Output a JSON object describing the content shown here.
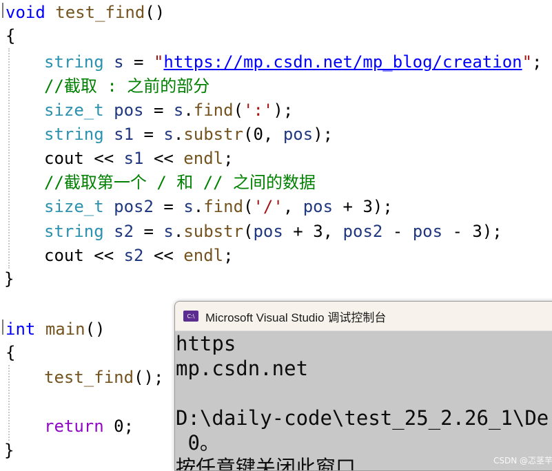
{
  "code": {
    "l1": {
      "kw": "void",
      "fn": "test_find",
      "rest": "()"
    },
    "l2": "{",
    "l3": {
      "type": "string",
      "var": "s",
      "op": " = ",
      "q1": "\"",
      "url": "https://mp.csdn.net/mp_blog/creation",
      "q2": "\"",
      "end": ";"
    },
    "l4": "//截取 : 之前的部分",
    "l5": {
      "type": "size_t",
      "var": "pos",
      "op": " = ",
      "obj": "s",
      "dot": ".",
      "fn": "find",
      "open": "(",
      "str": "':'",
      "close": ");"
    },
    "l6": {
      "type": "string",
      "var": "s1",
      "op": " = ",
      "obj": "s",
      "dot": ".",
      "fn": "substr",
      "args1": "(0, ",
      "arg": "pos",
      "close": ");"
    },
    "l7": {
      "cout": "cout << ",
      "var": "s1",
      "mid": " << ",
      "endl": "endl",
      "end": ";"
    },
    "l8": "//截取第一个 / 和 // 之间的数据",
    "l9": {
      "type": "size_t",
      "var": "pos2",
      "op": " = ",
      "obj": "s",
      "dot": ".",
      "fn": "find",
      "open": "(",
      "str": "'/'",
      "sep": ", ",
      "arg": "pos",
      "tail": " + 3);"
    },
    "l10": {
      "type": "string",
      "var": "s2",
      "op": " = ",
      "obj": "s",
      "dot": ".",
      "fn": "substr",
      "open": "(",
      "a1": "pos",
      "m1": " + 3, ",
      "a2": "pos2",
      "m2": " - ",
      "a3": "pos",
      "tail": " - 3);"
    },
    "l11": {
      "cout": "cout << ",
      "var": "s2",
      "mid": " << ",
      "endl": "endl",
      "end": ";"
    },
    "l12": "}",
    "l13": {
      "kw": "int",
      "fn": "main",
      "rest": "()"
    },
    "l14": "{",
    "l15": {
      "fn": "test_find",
      "rest": "();"
    },
    "l16": {
      "kw": "return",
      "rest": " 0;"
    },
    "l17": "}"
  },
  "console": {
    "title": "Microsoft Visual Studio 调试控制台",
    "icon_text": "C:\\",
    "lines": [
      "https",
      "mp.csdn.net",
      "",
      "D:\\daily-code\\test_25_2.26_1\\De",
      " 0。",
      "按任意键关闭此窗口"
    ]
  },
  "watermark": "CSDN @忑茎芉",
  "colors": {
    "keyword": "#0000ff",
    "type": "#2b91af",
    "comment": "#008000",
    "string": "#a31515",
    "console_bg": "#c8c8c8"
  }
}
